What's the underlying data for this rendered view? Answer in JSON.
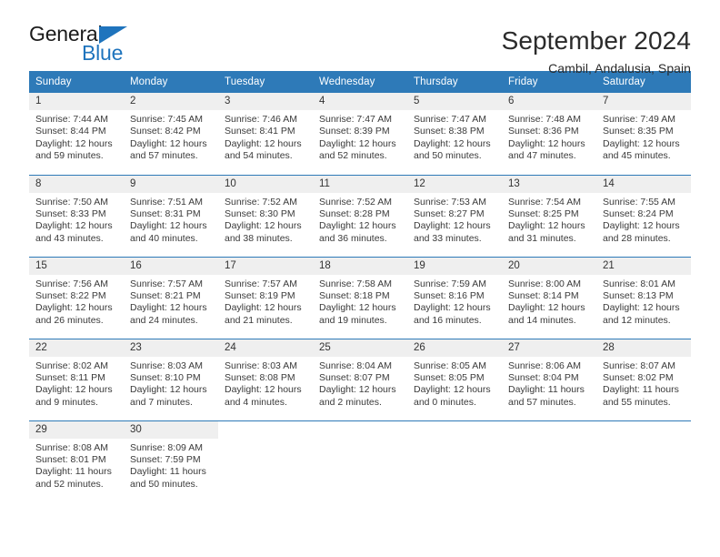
{
  "logo": {
    "word_primary": "General",
    "word_secondary": "Blue",
    "triangle_icon": "triangle-icon",
    "primary_color": "#1b1b1b",
    "accent_color": "#1f74bd"
  },
  "header": {
    "title": "September 2024",
    "subtitle": "Cambil, Andalusia, Spain"
  },
  "colors": {
    "header_row_bg": "#2e7ab8",
    "header_row_text": "#ffffff",
    "daynum_bg": "#efefef",
    "week_divider": "#2e7ab8",
    "body_text": "#3a3a3a"
  },
  "calendar": {
    "weekday_headers": [
      "Sunday",
      "Monday",
      "Tuesday",
      "Wednesday",
      "Thursday",
      "Friday",
      "Saturday"
    ],
    "weeks": [
      [
        {
          "day": "1",
          "sunrise": "Sunrise: 7:44 AM",
          "sunset": "Sunset: 8:44 PM",
          "daylight_line1": "Daylight: 12 hours",
          "daylight_line2": "and 59 minutes."
        },
        {
          "day": "2",
          "sunrise": "Sunrise: 7:45 AM",
          "sunset": "Sunset: 8:42 PM",
          "daylight_line1": "Daylight: 12 hours",
          "daylight_line2": "and 57 minutes."
        },
        {
          "day": "3",
          "sunrise": "Sunrise: 7:46 AM",
          "sunset": "Sunset: 8:41 PM",
          "daylight_line1": "Daylight: 12 hours",
          "daylight_line2": "and 54 minutes."
        },
        {
          "day": "4",
          "sunrise": "Sunrise: 7:47 AM",
          "sunset": "Sunset: 8:39 PM",
          "daylight_line1": "Daylight: 12 hours",
          "daylight_line2": "and 52 minutes."
        },
        {
          "day": "5",
          "sunrise": "Sunrise: 7:47 AM",
          "sunset": "Sunset: 8:38 PM",
          "daylight_line1": "Daylight: 12 hours",
          "daylight_line2": "and 50 minutes."
        },
        {
          "day": "6",
          "sunrise": "Sunrise: 7:48 AM",
          "sunset": "Sunset: 8:36 PM",
          "daylight_line1": "Daylight: 12 hours",
          "daylight_line2": "and 47 minutes."
        },
        {
          "day": "7",
          "sunrise": "Sunrise: 7:49 AM",
          "sunset": "Sunset: 8:35 PM",
          "daylight_line1": "Daylight: 12 hours",
          "daylight_line2": "and 45 minutes."
        }
      ],
      [
        {
          "day": "8",
          "sunrise": "Sunrise: 7:50 AM",
          "sunset": "Sunset: 8:33 PM",
          "daylight_line1": "Daylight: 12 hours",
          "daylight_line2": "and 43 minutes."
        },
        {
          "day": "9",
          "sunrise": "Sunrise: 7:51 AM",
          "sunset": "Sunset: 8:31 PM",
          "daylight_line1": "Daylight: 12 hours",
          "daylight_line2": "and 40 minutes."
        },
        {
          "day": "10",
          "sunrise": "Sunrise: 7:52 AM",
          "sunset": "Sunset: 8:30 PM",
          "daylight_line1": "Daylight: 12 hours",
          "daylight_line2": "and 38 minutes."
        },
        {
          "day": "11",
          "sunrise": "Sunrise: 7:52 AM",
          "sunset": "Sunset: 8:28 PM",
          "daylight_line1": "Daylight: 12 hours",
          "daylight_line2": "and 36 minutes."
        },
        {
          "day": "12",
          "sunrise": "Sunrise: 7:53 AM",
          "sunset": "Sunset: 8:27 PM",
          "daylight_line1": "Daylight: 12 hours",
          "daylight_line2": "and 33 minutes."
        },
        {
          "day": "13",
          "sunrise": "Sunrise: 7:54 AM",
          "sunset": "Sunset: 8:25 PM",
          "daylight_line1": "Daylight: 12 hours",
          "daylight_line2": "and 31 minutes."
        },
        {
          "day": "14",
          "sunrise": "Sunrise: 7:55 AM",
          "sunset": "Sunset: 8:24 PM",
          "daylight_line1": "Daylight: 12 hours",
          "daylight_line2": "and 28 minutes."
        }
      ],
      [
        {
          "day": "15",
          "sunrise": "Sunrise: 7:56 AM",
          "sunset": "Sunset: 8:22 PM",
          "daylight_line1": "Daylight: 12 hours",
          "daylight_line2": "and 26 minutes."
        },
        {
          "day": "16",
          "sunrise": "Sunrise: 7:57 AM",
          "sunset": "Sunset: 8:21 PM",
          "daylight_line1": "Daylight: 12 hours",
          "daylight_line2": "and 24 minutes."
        },
        {
          "day": "17",
          "sunrise": "Sunrise: 7:57 AM",
          "sunset": "Sunset: 8:19 PM",
          "daylight_line1": "Daylight: 12 hours",
          "daylight_line2": "and 21 minutes."
        },
        {
          "day": "18",
          "sunrise": "Sunrise: 7:58 AM",
          "sunset": "Sunset: 8:18 PM",
          "daylight_line1": "Daylight: 12 hours",
          "daylight_line2": "and 19 minutes."
        },
        {
          "day": "19",
          "sunrise": "Sunrise: 7:59 AM",
          "sunset": "Sunset: 8:16 PM",
          "daylight_line1": "Daylight: 12 hours",
          "daylight_line2": "and 16 minutes."
        },
        {
          "day": "20",
          "sunrise": "Sunrise: 8:00 AM",
          "sunset": "Sunset: 8:14 PM",
          "daylight_line1": "Daylight: 12 hours",
          "daylight_line2": "and 14 minutes."
        },
        {
          "day": "21",
          "sunrise": "Sunrise: 8:01 AM",
          "sunset": "Sunset: 8:13 PM",
          "daylight_line1": "Daylight: 12 hours",
          "daylight_line2": "and 12 minutes."
        }
      ],
      [
        {
          "day": "22",
          "sunrise": "Sunrise: 8:02 AM",
          "sunset": "Sunset: 8:11 PM",
          "daylight_line1": "Daylight: 12 hours",
          "daylight_line2": "and 9 minutes."
        },
        {
          "day": "23",
          "sunrise": "Sunrise: 8:03 AM",
          "sunset": "Sunset: 8:10 PM",
          "daylight_line1": "Daylight: 12 hours",
          "daylight_line2": "and 7 minutes."
        },
        {
          "day": "24",
          "sunrise": "Sunrise: 8:03 AM",
          "sunset": "Sunset: 8:08 PM",
          "daylight_line1": "Daylight: 12 hours",
          "daylight_line2": "and 4 minutes."
        },
        {
          "day": "25",
          "sunrise": "Sunrise: 8:04 AM",
          "sunset": "Sunset: 8:07 PM",
          "daylight_line1": "Daylight: 12 hours",
          "daylight_line2": "and 2 minutes."
        },
        {
          "day": "26",
          "sunrise": "Sunrise: 8:05 AM",
          "sunset": "Sunset: 8:05 PM",
          "daylight_line1": "Daylight: 12 hours",
          "daylight_line2": "and 0 minutes."
        },
        {
          "day": "27",
          "sunrise": "Sunrise: 8:06 AM",
          "sunset": "Sunset: 8:04 PM",
          "daylight_line1": "Daylight: 11 hours",
          "daylight_line2": "and 57 minutes."
        },
        {
          "day": "28",
          "sunrise": "Sunrise: 8:07 AM",
          "sunset": "Sunset: 8:02 PM",
          "daylight_line1": "Daylight: 11 hours",
          "daylight_line2": "and 55 minutes."
        }
      ],
      [
        {
          "day": "29",
          "sunrise": "Sunrise: 8:08 AM",
          "sunset": "Sunset: 8:01 PM",
          "daylight_line1": "Daylight: 11 hours",
          "daylight_line2": "and 52 minutes."
        },
        {
          "day": "30",
          "sunrise": "Sunrise: 8:09 AM",
          "sunset": "Sunset: 7:59 PM",
          "daylight_line1": "Daylight: 11 hours",
          "daylight_line2": "and 50 minutes."
        },
        {
          "day": "",
          "sunrise": "",
          "sunset": "",
          "daylight_line1": "",
          "daylight_line2": ""
        },
        {
          "day": "",
          "sunrise": "",
          "sunset": "",
          "daylight_line1": "",
          "daylight_line2": ""
        },
        {
          "day": "",
          "sunrise": "",
          "sunset": "",
          "daylight_line1": "",
          "daylight_line2": ""
        },
        {
          "day": "",
          "sunrise": "",
          "sunset": "",
          "daylight_line1": "",
          "daylight_line2": ""
        },
        {
          "day": "",
          "sunrise": "",
          "sunset": "",
          "daylight_line1": "",
          "daylight_line2": ""
        }
      ]
    ]
  }
}
